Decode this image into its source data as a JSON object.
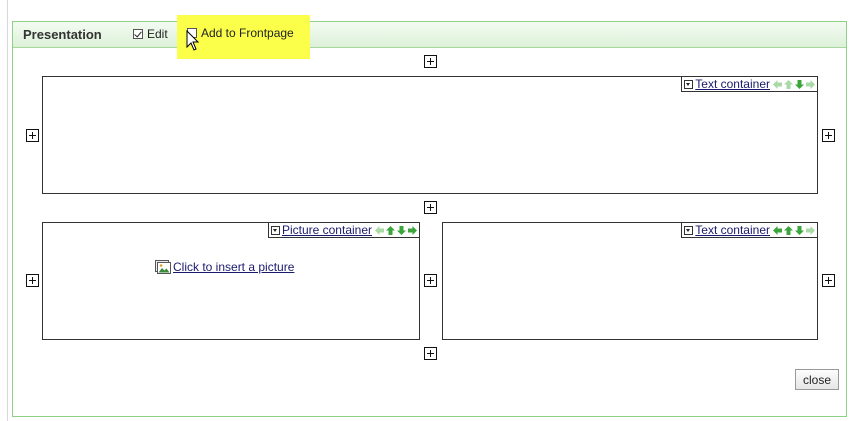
{
  "panel": {
    "title": "Presentation",
    "edit_label": "Edit",
    "edit_checked": true,
    "frontpage_label": "Add to Frontpage",
    "frontpage_checked": false,
    "highlight_color": "#fcff4a",
    "border_color": "#8fcf87"
  },
  "containers": {
    "top_text": {
      "label": "Text container"
    },
    "picture": {
      "label": "Picture container",
      "insert_label": "Click to insert a picture"
    },
    "right_text": {
      "label": "Text container"
    }
  },
  "icons": {
    "add": "plus-box-icon",
    "menu": "dropdown-toggle-icon",
    "move": [
      "arrow-left-icon",
      "arrow-up-icon",
      "arrow-down-icon",
      "arrow-right-icon"
    ],
    "picture": "picture-icon"
  },
  "arrow_color_active": "#3aa53a",
  "arrow_color_inactive": "#a9d9a4",
  "close_label": "close"
}
